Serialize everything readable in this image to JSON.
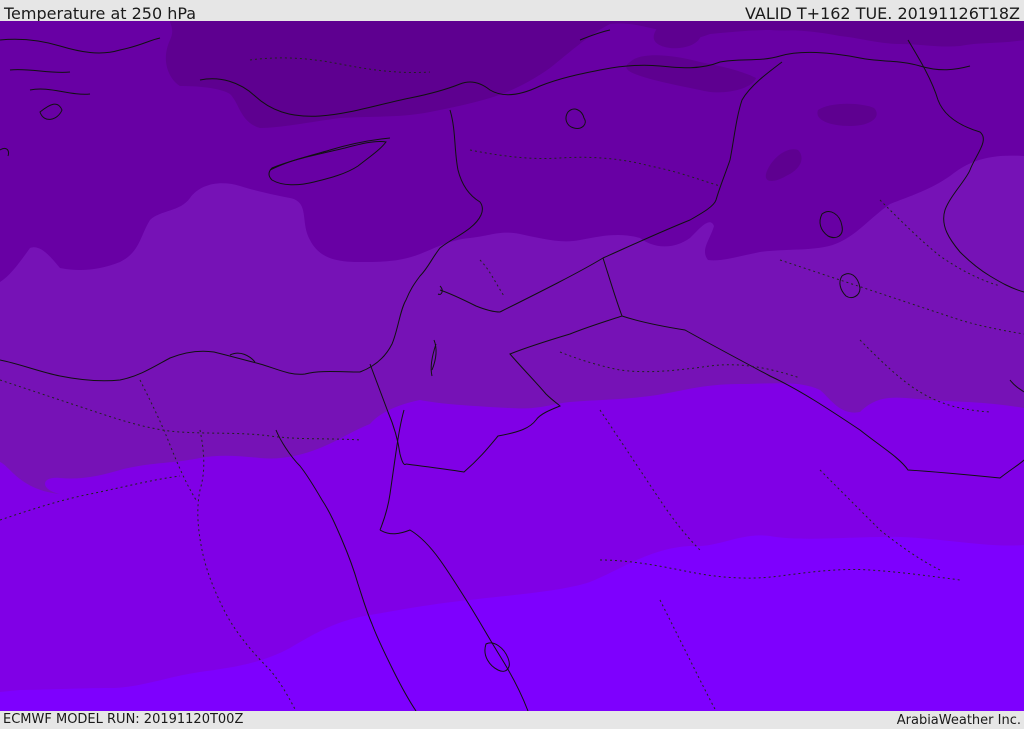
{
  "header": {
    "title": "Temperature at 250 hPa",
    "valid": "VALID T+162 TUE. 20191126T18Z"
  },
  "footer": {
    "model_run": "ECMWF MODEL RUN: 20191120T00Z",
    "credit": "ArabiaWeather Inc."
  },
  "map": {
    "variable": "temperature",
    "level": "250 hPa",
    "colors": {
      "band_1": "#5e0090",
      "band_2": "#6800a4",
      "band_3": "#7612b6",
      "band_4": "#8000e6",
      "band_5": "#7e00fe",
      "coastline": "#111111",
      "border": "#111111"
    }
  }
}
